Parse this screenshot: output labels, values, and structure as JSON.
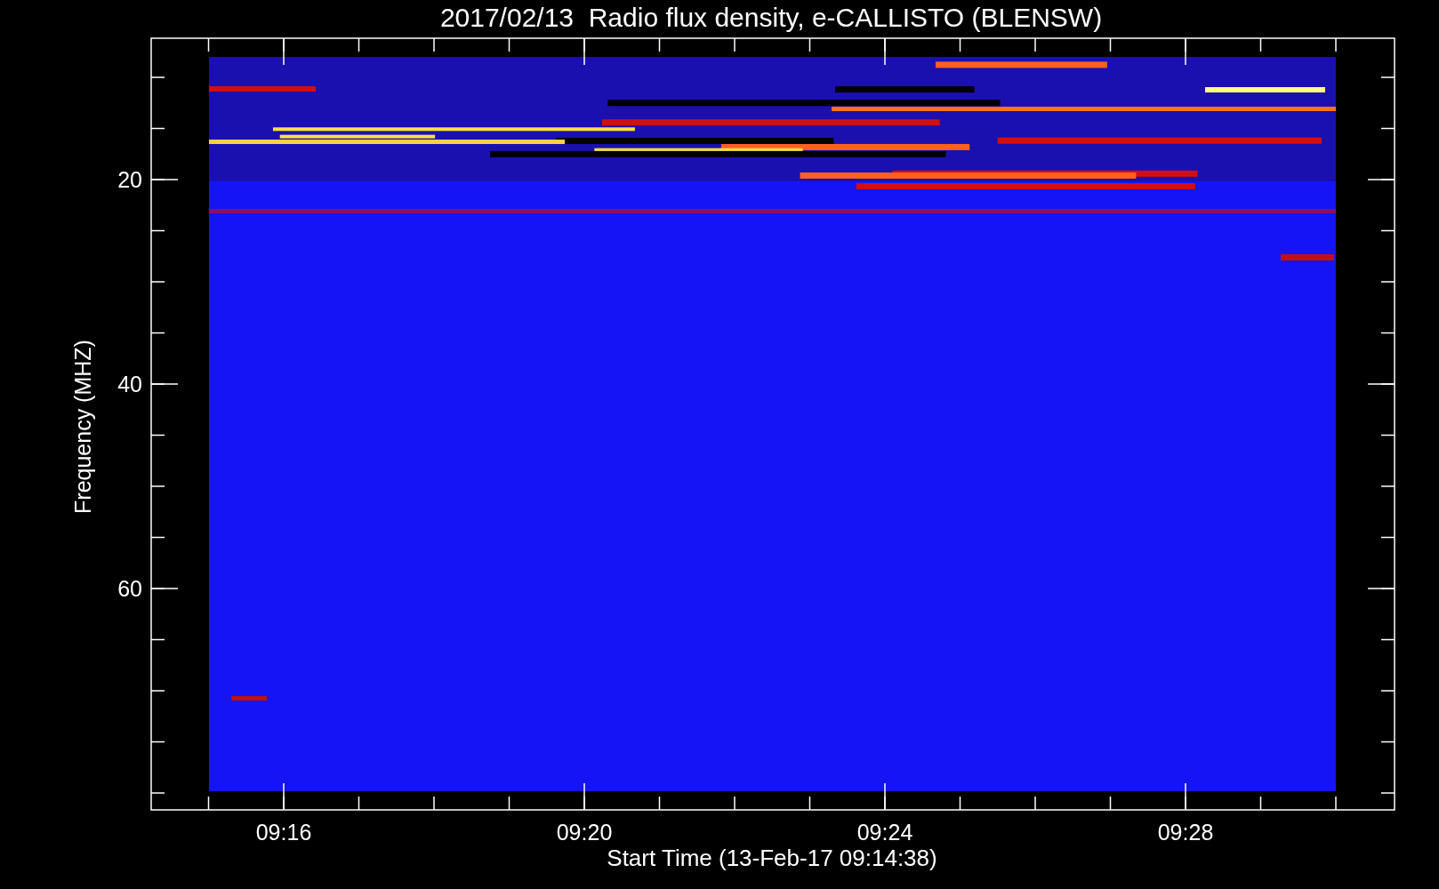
{
  "title": "2017/02/13  Radio flux density, e-CALLISTO (BLENSW)",
  "xlabel": "Start Time (13-Feb-17 09:14:38)",
  "ylabel": "Frequency (MHZ)",
  "xticks": [
    "09:16",
    "09:20",
    "09:24",
    "09:28"
  ],
  "yticks": [
    "20",
    "40",
    "60"
  ]
}
